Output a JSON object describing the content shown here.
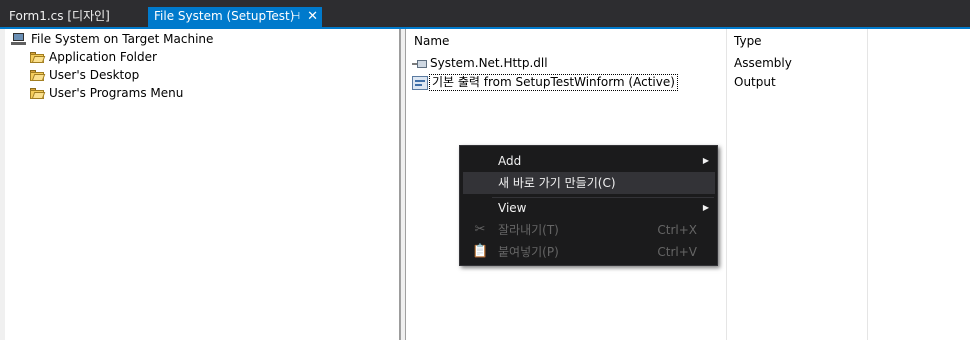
{
  "tabs": {
    "inactive": {
      "label": "Form1.cs [디자인]"
    },
    "active": {
      "label": "File System (SetupTest)",
      "pin": "⊣",
      "close": "✕"
    }
  },
  "tree": {
    "root": {
      "label": "File System on Target Machine",
      "icon": "computer-icon"
    },
    "children": [
      {
        "label": "Application Folder",
        "icon": "folder-icon"
      },
      {
        "label": "User's Desktop",
        "icon": "folder-icon"
      },
      {
        "label": "User's Programs Menu",
        "icon": "folder-icon"
      }
    ]
  },
  "list": {
    "columns": {
      "name": "Name",
      "type": "Type"
    },
    "rows": [
      {
        "name": "System.Net.Http.dll",
        "type": "Assembly",
        "icon": "assembly-icon"
      },
      {
        "name": "기본 출력 from SetupTestWinform (Active)",
        "type": "Output",
        "icon": "output-icon"
      }
    ]
  },
  "context_menu": {
    "items": [
      {
        "label": "Add",
        "submenu": true,
        "state": "enabled"
      },
      {
        "label": "새 바로 가기 만들기(C)",
        "state": "highlighted"
      },
      {
        "label": "View",
        "submenu": true,
        "state": "enabled"
      },
      {
        "label": "잘라내기(T)",
        "shortcut": "Ctrl+X",
        "state": "disabled",
        "icon": "cut-icon"
      },
      {
        "label": "붙여넣기(P)",
        "shortcut": "Ctrl+V",
        "state": "disabled",
        "icon": "paste-icon"
      }
    ],
    "submenu_arrow": "▶"
  },
  "colors": {
    "accent": "#007acc",
    "menu_bg": "#1b1b1c",
    "menu_hover": "#333337",
    "disabled_text": "#656565"
  }
}
